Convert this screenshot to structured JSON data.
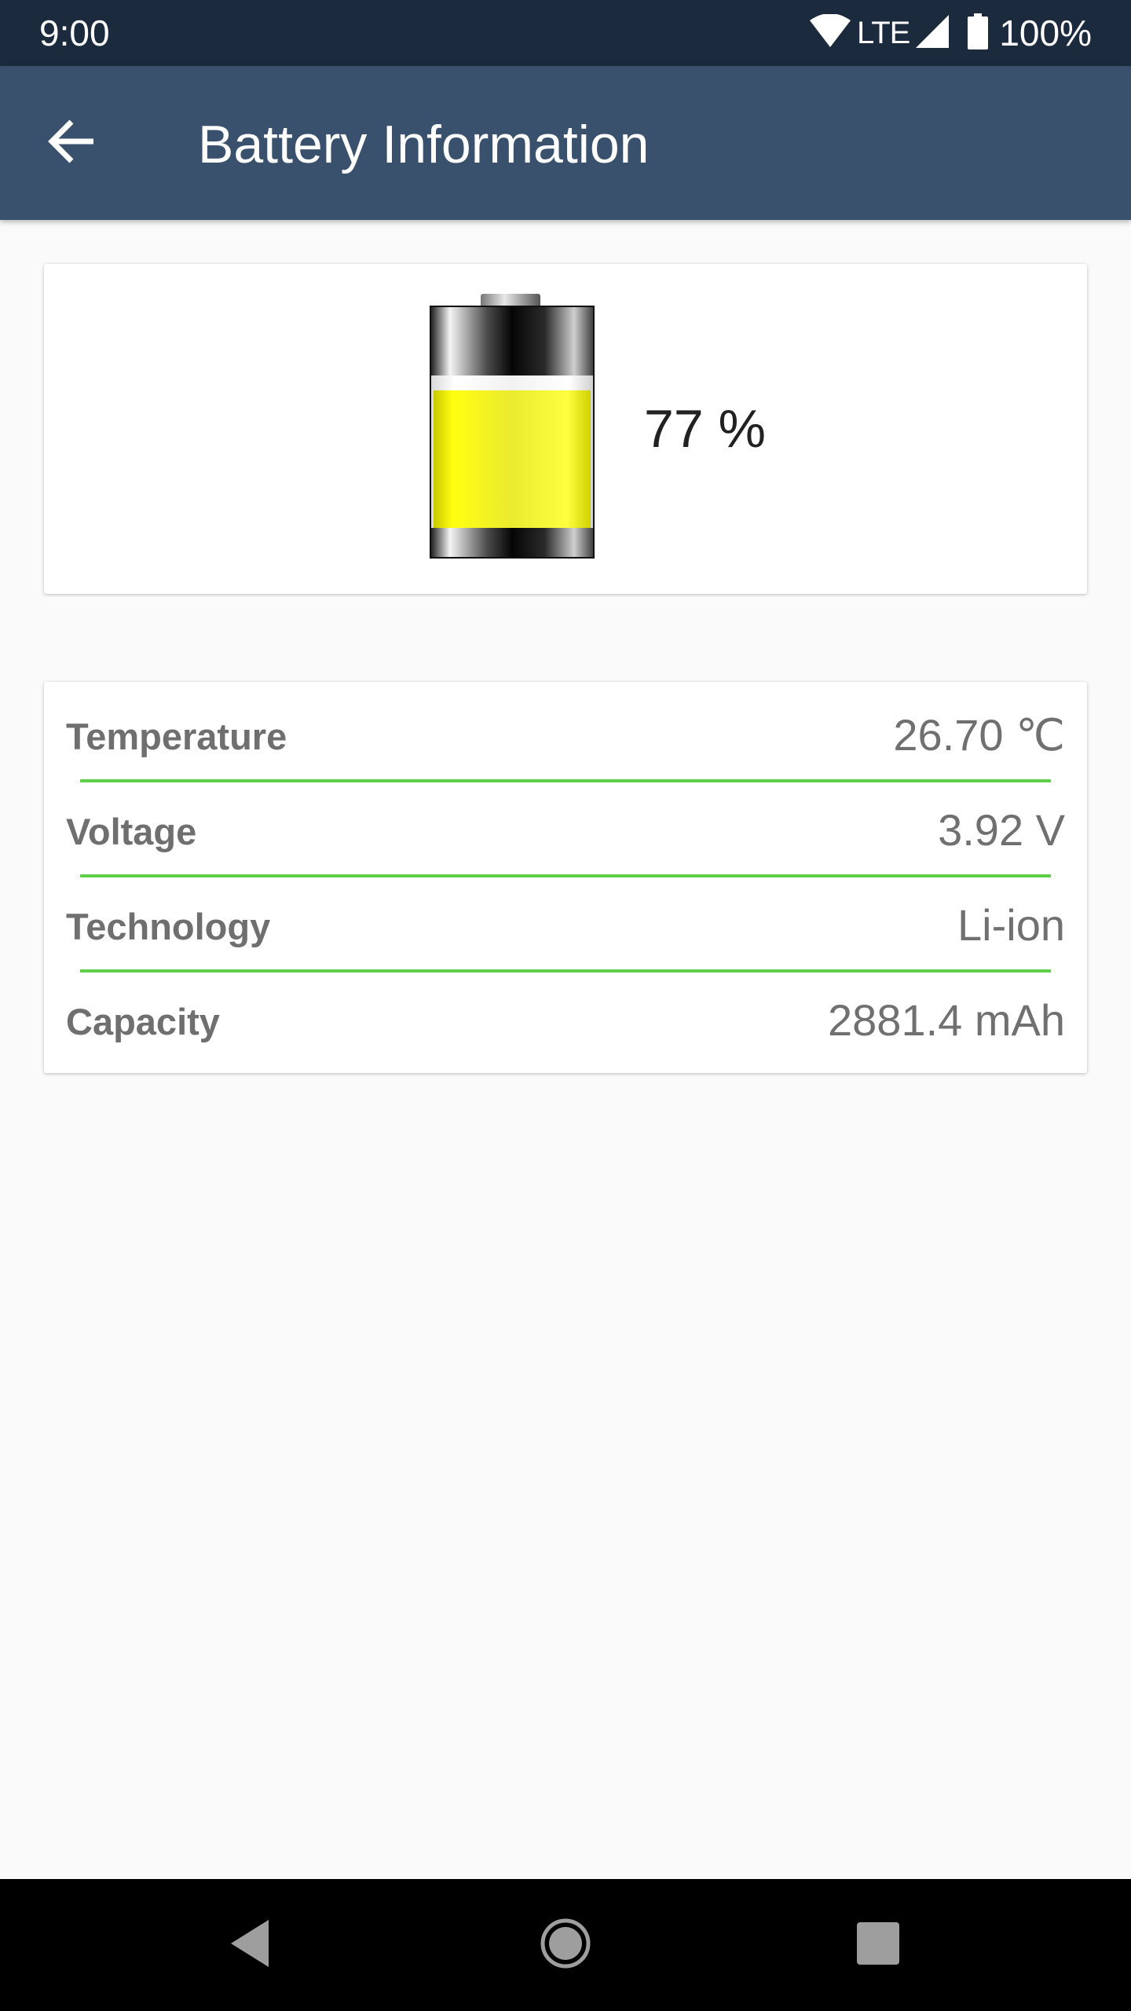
{
  "status_bar": {
    "time": "9:00",
    "network": "LTE",
    "battery_percent": "100%"
  },
  "app_bar": {
    "title": "Battery Information"
  },
  "battery": {
    "percent_text": "77 %",
    "level": 0.77,
    "fill_color": "#f2f200"
  },
  "info": {
    "rows": [
      {
        "label": "Temperature",
        "value": "26.70 ℃"
      },
      {
        "label": "Voltage",
        "value": "3.92 V"
      },
      {
        "label": "Technology",
        "value": "Li-ion"
      },
      {
        "label": "Capacity",
        "value": "2881.4 mAh"
      }
    ]
  },
  "colors": {
    "status_bar": "#1c2a3d",
    "app_bar": "#3a516d",
    "divider": "#5fcf4a",
    "background": "#fafafa"
  },
  "icons": {
    "back": "arrow-back-icon",
    "wifi": "wifi-icon",
    "signal": "cell-signal-icon",
    "status_battery": "battery-full-icon",
    "nav_back": "nav-back-icon",
    "nav_home": "nav-home-icon",
    "nav_recents": "nav-recents-icon"
  }
}
